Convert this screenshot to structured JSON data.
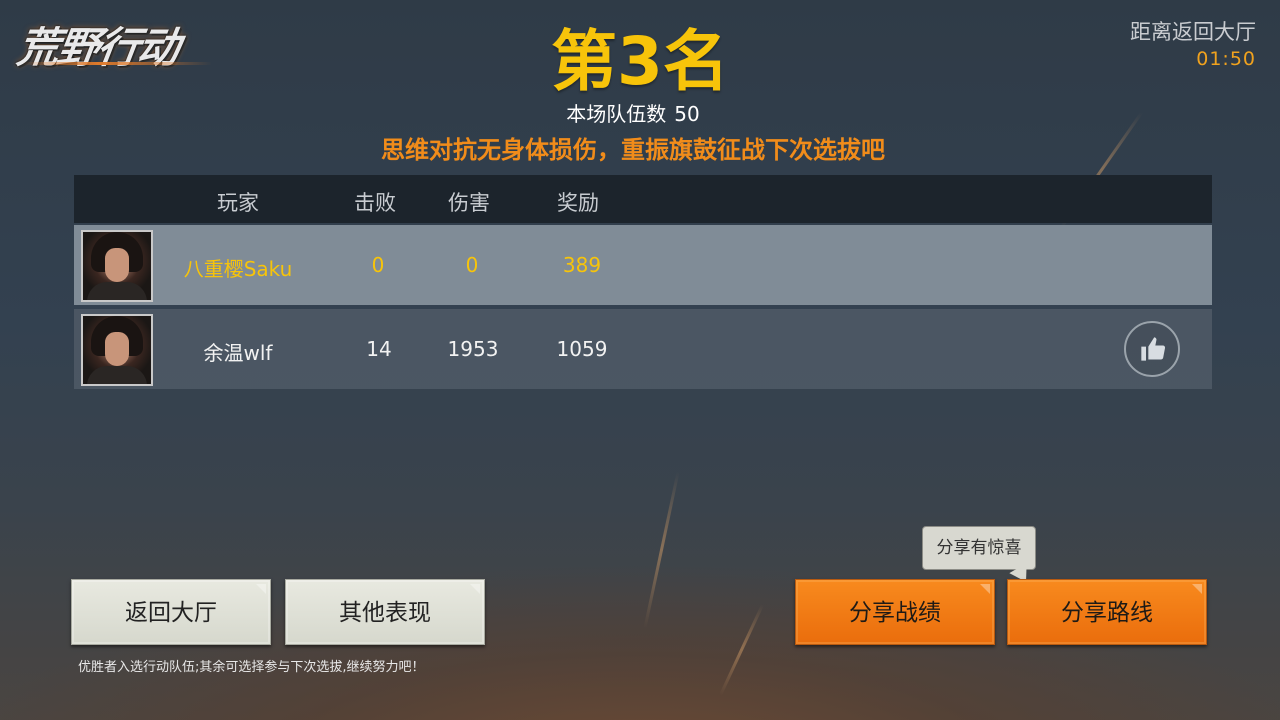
{
  "logo": {
    "text": "荒野行动"
  },
  "countdown": {
    "label": "距离返回大厅",
    "time": "01:50"
  },
  "result": {
    "rank_title": "第3名",
    "team_count_label": "本场队伍数",
    "team_count": "50",
    "encourage": "思维对抗无身体损伤，重振旗鼓征战下次选拔吧"
  },
  "table": {
    "headers": {
      "player": "玩家",
      "kills": "击败",
      "damage": "伤害",
      "reward": "奖励"
    },
    "rows": [
      {
        "player": "八重樱Saku",
        "kills": "0",
        "damage": "0",
        "reward": "389"
      },
      {
        "player": "余温wlf",
        "kills": "14",
        "damage": "1953",
        "reward": "1059"
      }
    ]
  },
  "buttons": {
    "back_lobby": "返回大厅",
    "other_perf": "其他表现",
    "share_stats": "分享战绩",
    "share_route": "分享路线"
  },
  "tooltip": {
    "text": "分享有惊喜"
  },
  "footer": {
    "tip": "优胜者入选行动队伍;其余可选择参与下次选拔,继续努力吧！"
  },
  "colors": {
    "gold": "#f7c40a",
    "orange_text": "#f18c1a",
    "button_orange": "#f07a14",
    "button_light": "#e0e2d8"
  },
  "icons": {
    "like": "thumbs-up-icon"
  }
}
